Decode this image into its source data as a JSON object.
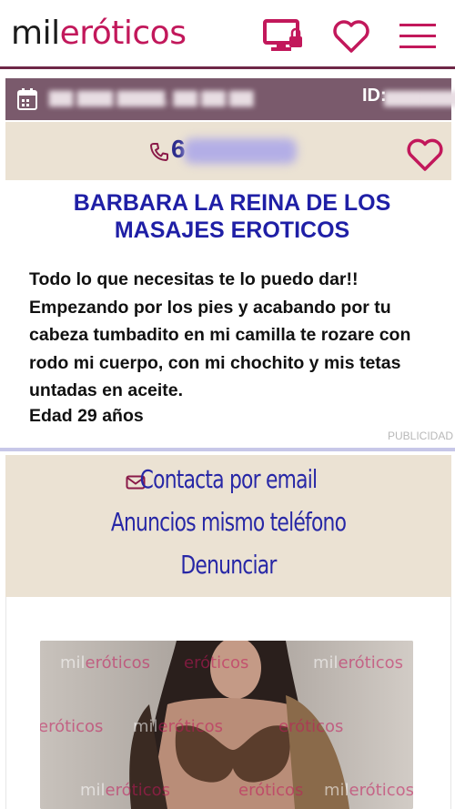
{
  "header": {
    "logo_part1": "mil",
    "logo_part2": "eróticos",
    "icons": [
      "computer-lock-icon",
      "heart-icon",
      "menu-icon"
    ],
    "accent_color": "#c2185b"
  },
  "meta": {
    "id_label": "ID:"
  },
  "phone": {
    "visible_digit": "6"
  },
  "ad": {
    "title": "BARBARA LA REINA DE LOS MASAJES EROTICOS",
    "description": "Todo lo que necesitas te lo puedo dar!!\nEmpezando por los pies y acabando por tu cabeza tumbadito en mi camilla te rozare con  rodo mi cuerpo, con mi chochito y mis tetas untadas en aceite.",
    "age": "Edad 29 años",
    "advertising_label": "PUBLICIDAD"
  },
  "contact": {
    "email_label": "Contacta por email",
    "same_phone_label": "Anuncios mismo teléfono",
    "report_label": "Denunciar"
  },
  "photo": {
    "watermark_part1": "mil",
    "watermark_part2": "eróticos"
  },
  "colors": {
    "header_border": "#6e2747",
    "meta_bar": "#7a5a6c",
    "beige_panel": "#ebe2d3",
    "title_blue": "#1f1fa6"
  }
}
